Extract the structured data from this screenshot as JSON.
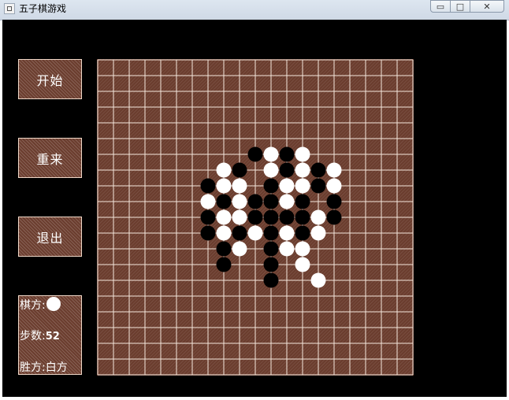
{
  "window": {
    "title": "五子棋游戏",
    "minimize_glyph": "▭",
    "maximize_glyph": "□",
    "close_glyph": "✕"
  },
  "menu": {
    "start_label": "开始",
    "restart_label": "重来",
    "exit_label": "退出"
  },
  "status": {
    "turn_label": "棋方:",
    "turn_stone": "white",
    "steps_label": "步数:",
    "steps_value": "52",
    "winner_label": "胜方:",
    "winner_value": "白方"
  },
  "board": {
    "grid_lines": 21,
    "board_color": "#6b3d2e",
    "line_color": "#f4e6dc",
    "black_stones": [
      [
        10,
        6
      ],
      [
        12,
        6
      ],
      [
        9,
        7
      ],
      [
        12,
        7
      ],
      [
        14,
        7
      ],
      [
        7,
        8
      ],
      [
        11,
        8
      ],
      [
        14,
        8
      ],
      [
        8,
        9
      ],
      [
        10,
        9
      ],
      [
        11,
        9
      ],
      [
        13,
        9
      ],
      [
        15,
        9
      ],
      [
        7,
        10
      ],
      [
        10,
        10
      ],
      [
        11,
        10
      ],
      [
        12,
        10
      ],
      [
        13,
        10
      ],
      [
        15,
        10
      ],
      [
        7,
        11
      ],
      [
        9,
        11
      ],
      [
        11,
        11
      ],
      [
        13,
        11
      ],
      [
        8,
        12
      ],
      [
        11,
        12
      ],
      [
        8,
        13
      ],
      [
        11,
        13
      ],
      [
        11,
        14
      ]
    ],
    "white_stones": [
      [
        11,
        6
      ],
      [
        13,
        6
      ],
      [
        8,
        7
      ],
      [
        11,
        7
      ],
      [
        13,
        7
      ],
      [
        15,
        7
      ],
      [
        8,
        8
      ],
      [
        9,
        8
      ],
      [
        12,
        8
      ],
      [
        13,
        8
      ],
      [
        15,
        8
      ],
      [
        7,
        9
      ],
      [
        9,
        9
      ],
      [
        12,
        9
      ],
      [
        8,
        10
      ],
      [
        9,
        10
      ],
      [
        14,
        10
      ],
      [
        8,
        11
      ],
      [
        10,
        11
      ],
      [
        12,
        11
      ],
      [
        14,
        11
      ],
      [
        9,
        12
      ],
      [
        12,
        12
      ],
      [
        13,
        12
      ],
      [
        13,
        13
      ],
      [
        14,
        14
      ]
    ]
  }
}
